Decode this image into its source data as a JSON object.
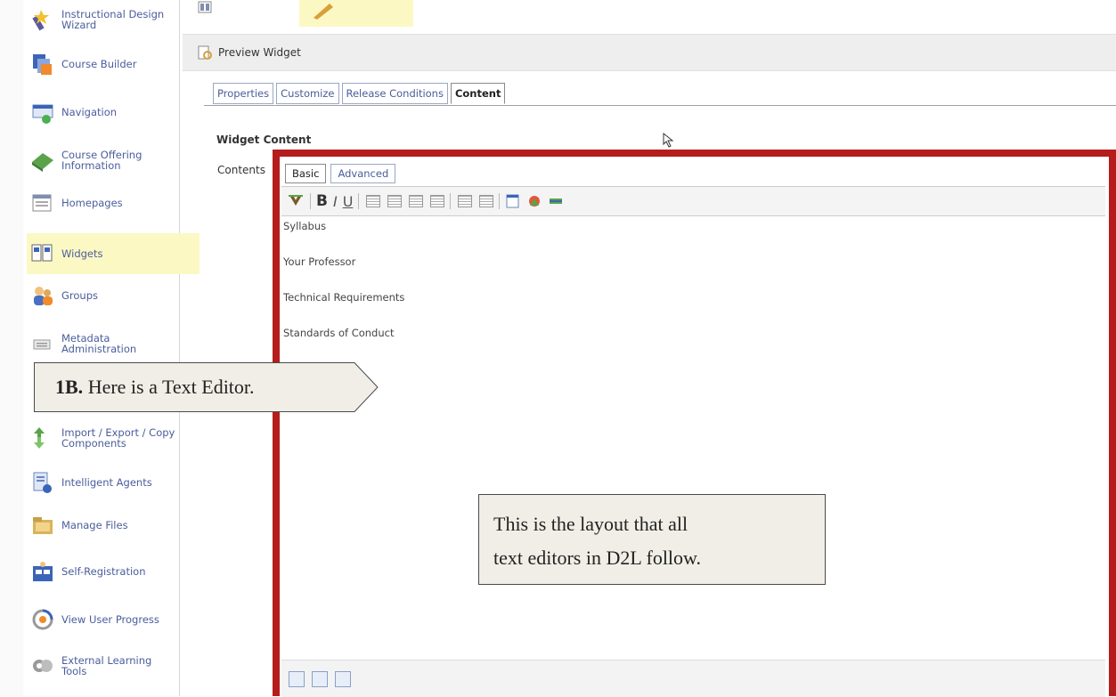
{
  "sidebar": {
    "items": [
      {
        "label": "Instructional Design Wizard",
        "icon": "wand-icon"
      },
      {
        "label": "Course Builder",
        "icon": "course-builder-icon"
      },
      {
        "label": "Navigation",
        "icon": "navigation-icon"
      },
      {
        "label": "Course Offering Information",
        "icon": "book-icon"
      },
      {
        "label": "Homepages",
        "icon": "homepage-icon"
      },
      {
        "label": "Widgets",
        "icon": "widgets-icon"
      },
      {
        "label": "Groups",
        "icon": "groups-icon"
      },
      {
        "label": "Metadata Administration",
        "icon": "metadata-icon"
      },
      {
        "label": "Import / Export / Copy Components",
        "icon": "import-export-icon"
      },
      {
        "label": "Intelligent Agents",
        "icon": "intelligent-agents-icon"
      },
      {
        "label": "Manage Files",
        "icon": "folder-icon"
      },
      {
        "label": "Self-Registration",
        "icon": "self-registration-icon"
      },
      {
        "label": "View User Progress",
        "icon": "user-progress-icon"
      },
      {
        "label": "External Learning Tools",
        "icon": "external-tools-icon"
      }
    ]
  },
  "preview": {
    "label": "Preview Widget"
  },
  "tabs": [
    "Properties",
    "Customize",
    "Release Conditions",
    "Content"
  ],
  "widget_content_label": "Widget Content",
  "contents_label": "Contents",
  "editor": {
    "tabs": [
      "Basic",
      "Advanced"
    ],
    "toolbar": {
      "bold": "B",
      "italic": "I",
      "underline": "U"
    },
    "lines": [
      "Syllabus",
      "Your Professor",
      "Technical Requirements",
      "Standards of Conduct"
    ]
  },
  "callout1": {
    "bold": "1B.",
    "text": " Here is a Text Editor."
  },
  "callout2": {
    "line1": "This is the layout that all",
    "line2": "text editors in D2L follow."
  },
  "colors": {
    "highlight_frame": "#b51c1c",
    "active_nav": "#fbf8c4",
    "link": "#4a5d9c"
  }
}
